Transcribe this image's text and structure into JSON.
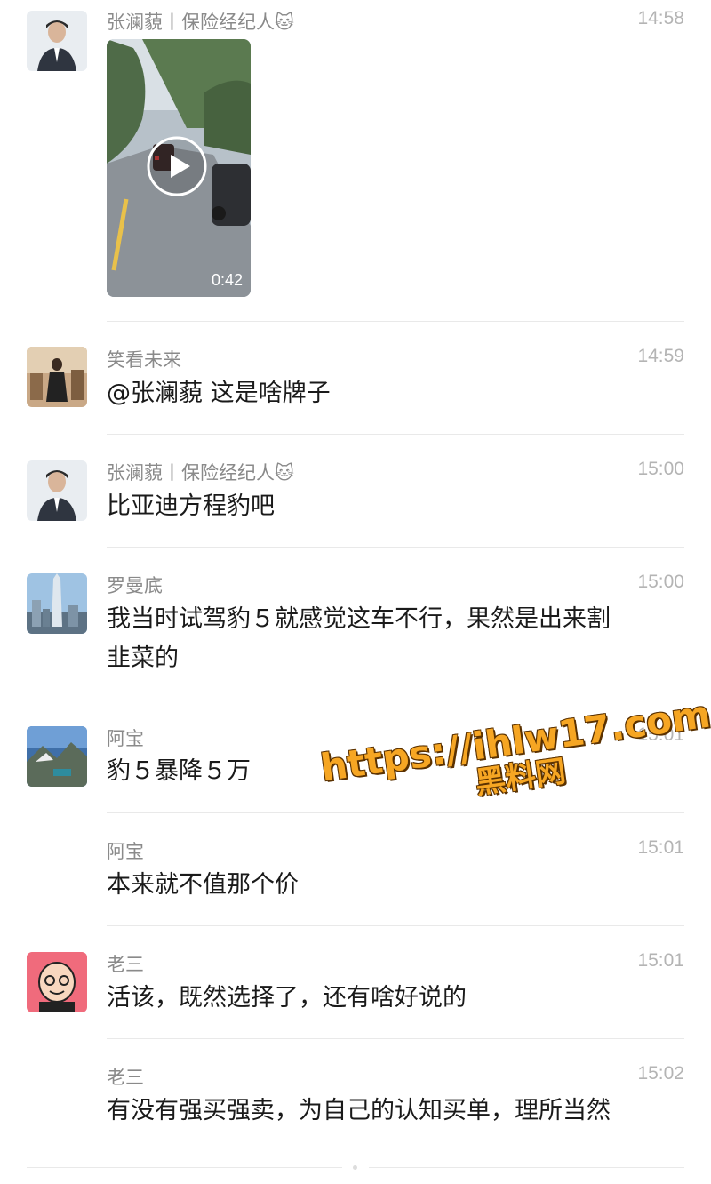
{
  "messages": [
    {
      "name": "张澜藐丨保险经纪人🐱",
      "time": "14:58",
      "text": "",
      "video_duration": "0:42"
    },
    {
      "name": "笑看未来",
      "time": "14:59",
      "text": "@张澜藐 这是啥牌子"
    },
    {
      "name": "张澜藐丨保险经纪人🐱",
      "time": "15:00",
      "text": "比亚迪方程豹吧"
    },
    {
      "name": "罗曼底",
      "time": "15:00",
      "text": "我当时试驾豹５就感觉这车不行，果然是出来割",
      "text2": "韭菜的"
    },
    {
      "name": "阿宝",
      "time": "15:01",
      "text": "豹５暴降５万"
    },
    {
      "name": "阿宝",
      "time": "15:01",
      "text": "本来就不值那个价"
    },
    {
      "name": "老三",
      "time": "15:01",
      "text": "活该，既然选择了，还有啥好说的"
    },
    {
      "name": "老三",
      "time": "15:02",
      "text": "有没有强买强卖，为自己的认知买单，理所当然"
    }
  ],
  "watermark": {
    "url": "https://ihlw17.com",
    "name": "黑料网"
  },
  "colors": {
    "name": "#8a8a8a",
    "time": "#b4b4b4",
    "text": "#1a1a1a",
    "watermark": "#f6a623"
  },
  "icons": [
    "play-icon",
    "cat-emoji"
  ]
}
